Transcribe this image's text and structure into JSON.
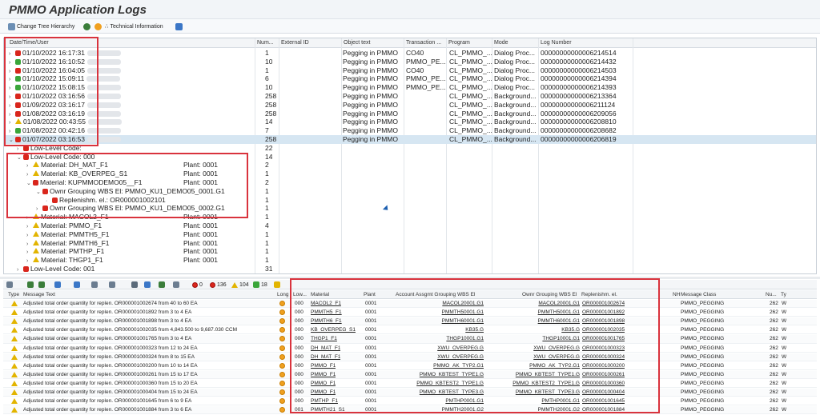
{
  "title": "PMMO Application Logs",
  "toolbar": {
    "change_tree": "Change Tree Hierarchy",
    "technical_info": "Technical Information"
  },
  "tree_header": {
    "date_time_user": "Date/Time/User",
    "number": "Num...",
    "external_id": "External ID",
    "object_text": "Object text",
    "transaction": "Transaction ...",
    "program": "Program",
    "mode": "Mode",
    "log_number": "Log Number"
  },
  "log_rows": [
    {
      "status": "red",
      "datetime": "01/10/2022  16:17:31",
      "num": "1",
      "object_text": "Pegging in PMMO",
      "transaction": "CO40",
      "program": "CL_PMMO_...",
      "mode": "Dialog Proc...",
      "log_number": "00000000000006214514"
    },
    {
      "status": "green",
      "datetime": "01/10/2022  16:10:52",
      "num": "10",
      "object_text": "Pegging in PMMO",
      "transaction": "PMMO_PE...",
      "program": "CL_PMMO_...",
      "mode": "Dialog Proc...",
      "log_number": "00000000000006214432"
    },
    {
      "status": "red",
      "datetime": "01/10/2022  16:04:05",
      "num": "1",
      "object_text": "Pegging in PMMO",
      "transaction": "CO40",
      "program": "CL_PMMO_...",
      "mode": "Dialog Proc...",
      "log_number": "00000000000006214503"
    },
    {
      "status": "green",
      "datetime": "01/10/2022  15:09:11",
      "num": "6",
      "object_text": "Pegging in PMMO",
      "transaction": "PMMO_PE...",
      "program": "CL_PMMO_...",
      "mode": "Dialog Proc...",
      "log_number": "00000000000006214394"
    },
    {
      "status": "green",
      "datetime": "01/10/2022  15:08:15",
      "num": "10",
      "object_text": "Pegging in PMMO",
      "transaction": "PMMO_PE...",
      "program": "CL_PMMO_...",
      "mode": "Dialog Proc...",
      "log_number": "00000000000006214393"
    },
    {
      "status": "red",
      "datetime": "01/10/2022  03:16:56",
      "num": "258",
      "object_text": "Pegging in PMMO",
      "transaction": "",
      "program": "CL_PMMO_...",
      "mode": "Background...",
      "log_number": "00000000000006213364"
    },
    {
      "status": "red",
      "datetime": "01/09/2022  03:16:17",
      "num": "258",
      "object_text": "Pegging in PMMO",
      "transaction": "",
      "program": "CL_PMMO_...",
      "mode": "Background...",
      "log_number": "00000000000006211124"
    },
    {
      "status": "red",
      "datetime": "01/08/2022  03:16:19",
      "num": "258",
      "object_text": "Pegging in PMMO",
      "transaction": "",
      "program": "CL_PMMO_...",
      "mode": "Background...",
      "log_number": "00000000000006209056"
    },
    {
      "status": "yellow",
      "datetime": "01/08/2022  00:43:55",
      "num": "14",
      "object_text": "Pegging in PMMO",
      "transaction": "",
      "program": "CL_PMMO_...",
      "mode": "Background...",
      "log_number": "00000000000006208810"
    },
    {
      "status": "green",
      "datetime": "01/08/2022  00:42:16",
      "num": "7",
      "object_text": "Pegging in PMMO",
      "transaction": "",
      "program": "CL_PMMO_...",
      "mode": "Background...",
      "log_number": "00000000000006208682"
    },
    {
      "status": "red",
      "datetime": "01/07/2022  03:16:53",
      "num": "258",
      "object_text": "Pegging in PMMO",
      "transaction": "",
      "program": "CL_PMMO_...",
      "mode": "Background...",
      "log_number": "00000000000006206819"
    }
  ],
  "tree_nodes": [
    {
      "status": "red",
      "label": "Low-Level Code:",
      "plant": "",
      "num": "22"
    },
    {
      "status": "red",
      "label": "Low-Level Code: 000",
      "plant": "",
      "num": "14"
    },
    {
      "status": "yellow",
      "label": "Material: DH_MAT_F1",
      "plant": "Plant: 0001",
      "num": "2"
    },
    {
      "status": "yellow",
      "label": "Material: KB_OVERPEG_S1",
      "plant": "Plant: 0001",
      "num": "1"
    },
    {
      "status": "red",
      "label": "Material: KUPMMODEMO05__F1",
      "plant": "Plant: 0001",
      "num": "2"
    },
    {
      "status": "red",
      "label": "Ownr Grouping WBS El: PMMO_KU1_DEMO05_0001.G1",
      "plant": "",
      "num": "1"
    },
    {
      "status": "red",
      "label": "Replenishm. el.: OR000001002101",
      "plant": "",
      "num": "1"
    },
    {
      "status": "red",
      "label": "Ownr Grouping WBS El: PMMO_KU1_DEMO05_0002.G1",
      "plant": "",
      "num": "1"
    },
    {
      "status": "yellow",
      "label": "Material: MACOL2_F1",
      "plant": "Plant: 0001",
      "num": "1"
    },
    {
      "status": "yellow",
      "label": "Material: PMMO_F1",
      "plant": "Plant: 0001",
      "num": "4"
    },
    {
      "status": "yellow",
      "label": "Material: PMMTH5_F1",
      "plant": "Plant: 0001",
      "num": "1"
    },
    {
      "status": "yellow",
      "label": "Material: PMMTH6_F1",
      "plant": "Plant: 0001",
      "num": "1"
    },
    {
      "status": "yellow",
      "label": "Material: PMTHP_F1",
      "plant": "Plant: 0001",
      "num": "1"
    },
    {
      "status": "yellow",
      "label": "Material: THGP1_F1",
      "plant": "Plant: 0001",
      "num": "1"
    },
    {
      "status": "red",
      "label": "Low-Level Code: 001",
      "plant": "",
      "num": "31"
    }
  ],
  "msg_toolbar": {
    "red_count": "0",
    "orange_count": "136",
    "yellow_count": "104",
    "green_count": "18"
  },
  "msg_header": {
    "type": "Type",
    "message_text": "Message Text",
    "long": "Long",
    "low": "Low...",
    "material": "Material",
    "plant": "Plant",
    "acct_wbs": "Account Assgmt Grouping WBS El",
    "ownr_wbs": "Ownr Grouping WBS El",
    "replenishm": "Replenishm. el.",
    "nh": "NH",
    "message_class": "Message Class",
    "nu": "Nu...",
    "ty": "Ty"
  },
  "messages": [
    {
      "text": "Adjusted total order quantity for replen. OR000001002674 from 40 to 60 EA",
      "low": "000",
      "material": "MACOL2_F1",
      "plant": "0001",
      "acct": "MACOL20001.G1",
      "ownr": "MACOL20001.G1",
      "repl": "OR000001002674",
      "cls": "PMMO_PEGGING",
      "nu": "262",
      "ty": "W"
    },
    {
      "text": "Adjusted total order quantity for replen. OR000001001892 from 3 to 4 EA",
      "low": "000",
      "material": "PMMTH5_F1",
      "plant": "0001",
      "acct": "PMMTH50001.G1",
      "ownr": "PMMTH50001.G1",
      "repl": "OR000001001892",
      "cls": "PMMO_PEGGING",
      "nu": "262",
      "ty": "W"
    },
    {
      "text": "Adjusted total order quantity for replen. OR000001001898 from 3 to 4 EA",
      "low": "000",
      "material": "PMMTH6_F1",
      "plant": "0001",
      "acct": "PMMTH60001.G1",
      "ownr": "PMMTH60001.G1",
      "repl": "OR000001001898",
      "cls": "PMMO_PEGGING",
      "nu": "262",
      "ty": "W"
    },
    {
      "text": "Adjusted total order quantity for replen. OR000001002035 from 4,843.500 to 9,687.030 CCM",
      "low": "000",
      "material": "KB_OVERPEG_S1",
      "plant": "0001",
      "acct": "KB35.G",
      "ownr": "KB35.G",
      "repl": "OR000001002035",
      "cls": "PMMO_PEGGING",
      "nu": "262",
      "ty": "W"
    },
    {
      "text": "Adjusted total order quantity for replen. OR000001001765 from 3 to 4 EA",
      "low": "000",
      "material": "THGP1_F1",
      "plant": "0001",
      "acct": "THGP10001.G1",
      "ownr": "THGP10001.G1",
      "repl": "OR000001001765",
      "cls": "PMMO_PEGGING",
      "nu": "262",
      "ty": "W"
    },
    {
      "text": "Adjusted total order quantity for replen. OR000001000323 from 12 to 24 EA",
      "low": "000",
      "material": "DH_MAT_F1",
      "plant": "0001",
      "acct": "XWU_OVERPEG.G",
      "ownr": "XWU_OVERPEG.G",
      "repl": "OR000001000323",
      "cls": "PMMO_PEGGING",
      "nu": "262",
      "ty": "W"
    },
    {
      "text": "Adjusted total order quantity for replen. OR000001000324 from 8 to 15 EA",
      "low": "000",
      "material": "DH_MAT_F1",
      "plant": "0001",
      "acct": "XWU_OVERPEG.G",
      "ownr": "XWU_OVERPEG.G",
      "repl": "OR000001000324",
      "cls": "PMMO_PEGGING",
      "nu": "262",
      "ty": "W"
    },
    {
      "text": "Adjusted total order quantity for replen. OR000001000200 from 10 to 14 EA",
      "low": "000",
      "material": "PMMO_F1",
      "plant": "0001",
      "acct": "PMMO_AK_TYP2.G1",
      "ownr": "PMMO_AK_TYP2.G1",
      "repl": "OR000001000200",
      "cls": "PMMO_PEGGING",
      "nu": "262",
      "ty": "W"
    },
    {
      "text": "Adjusted total order quantity for replen. OR000001000261 from 15 to 17 EA",
      "low": "000",
      "material": "PMMO_F1",
      "plant": "0001",
      "acct": "PMMO_KBTEST_TYPE1.G",
      "ownr": "PMMO_KBTEST_TYPE1.G",
      "repl": "OR000001000261",
      "cls": "PMMO_PEGGING",
      "nu": "262",
      "ty": "W"
    },
    {
      "text": "Adjusted total order quantity for replen. OR000001000360 from 15 to 20 EA",
      "low": "000",
      "material": "PMMO_F1",
      "plant": "0001",
      "acct": "PMMO_KBTEST2_TYPE1.G",
      "ownr": "PMMO_KBTEST2_TYPE1.G",
      "repl": "OR000001000360",
      "cls": "PMMO_PEGGING",
      "nu": "262",
      "ty": "W"
    },
    {
      "text": "Adjusted total order quantity for replen. OR000001000404 from 15 to 24 EA",
      "low": "000",
      "material": "PMMO_F1",
      "plant": "0001",
      "acct": "PMMO_KBTEST_TYPE3.G",
      "ownr": "PMMO_KBTEST_TYPE3.G",
      "repl": "OR000001000404",
      "cls": "PMMO_PEGGING",
      "nu": "262",
      "ty": "W"
    },
    {
      "text": "Adjusted total order quantity for replen. OR000001001645 from 6 to 9 EA",
      "low": "000",
      "material": "PMTHP_F1",
      "plant": "0001",
      "acct": "PMTHP0001.G1",
      "ownr": "PMTHP0001.G1",
      "repl": "OR000001001645",
      "cls": "PMMO_PEGGING",
      "nu": "262",
      "ty": "W"
    },
    {
      "text": "Adjusted total order quantity for replen. OR000001001884 from 3 to 6 EA",
      "low": "001",
      "material": "PMMTH21_S1",
      "plant": "0001",
      "acct": "PMMTH20001.G2",
      "ownr": "PMMTH20001.G2",
      "repl": "OR000001001884",
      "cls": "PMMO_PEGGING",
      "nu": "262",
      "ty": "W"
    }
  ]
}
